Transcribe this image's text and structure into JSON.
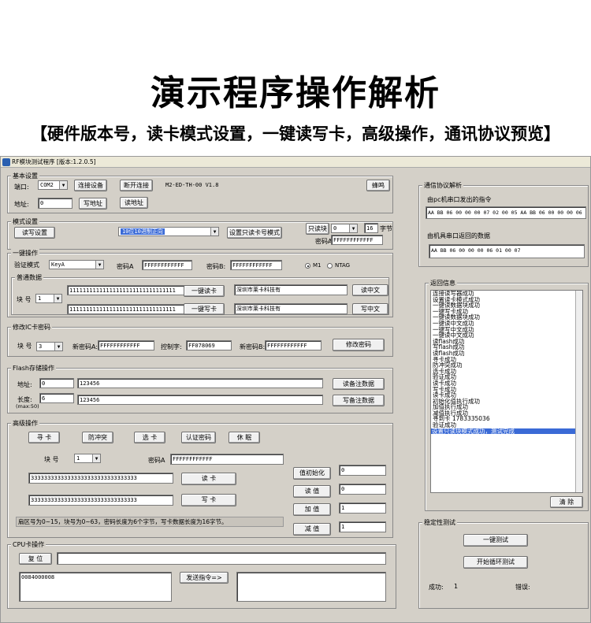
{
  "header": {
    "title": "演示程序操作解析",
    "subtitle": "【硬件版本号，读卡模式设置，一键读写卡，高级操作，通讯协议预览】"
  },
  "window": {
    "title": "RF模块测试程序 [版本:1.2.0.5]"
  },
  "basic": {
    "group": "基本设置",
    "port_label": "端口:",
    "port_value": "COM2",
    "connect": "连接设备",
    "disconnect": "断开连接",
    "version": "M2-ED-TH-00 V1.8",
    "buzzer": "蜂鸣",
    "addr_label": "地址:",
    "addr_value": "0",
    "write_addr": "写地址",
    "read_addr": "读地址"
  },
  "mode": {
    "group": "模式设置",
    "read_settings": "读写设置",
    "mode_value": "10位10进制正向",
    "set_mode": "设置只读卡号模式",
    "readonly_block": "只读块",
    "block_value": "0",
    "bytes_value": "16",
    "bytes_unit": "字节",
    "key_label": "密码A",
    "key_value": "FFFFFFFFFFFF"
  },
  "onekey": {
    "group": "一键操作",
    "verify_label": "验证模式",
    "verify_value": "KeyA",
    "keyA_label": "密码A",
    "keyA_value": "FFFFFFFFFFFF",
    "keyB_label": "密码B:",
    "keyB_value": "FFFFFFFFFFFF",
    "m1": "M1",
    "ntag": "NTAG",
    "normal_group": "普通数据",
    "block_label": "块 号",
    "block_value": "1",
    "data1": "11111111111111111111111111111111",
    "data2": "11111111111111111111111111111111",
    "read_card": "一键读卡",
    "write_card": "一键写卡",
    "cn1": "深圳市莱卡科技有",
    "cn2": "深圳市莱卡科技有",
    "read_cn": "读中文",
    "write_cn": "写中文"
  },
  "ic": {
    "group": "修改IC卡密码",
    "block_label": "块 号",
    "block_value": "3",
    "newA_label": "新密码A:",
    "newA_value": "FFFFFFFFFFFF",
    "ctrl_label": "控制字:",
    "ctrl_value": "FF078069",
    "newB_label": "新密码B:",
    "newB_value": "FFFFFFFFFFFF",
    "modify": "修改密码"
  },
  "flash": {
    "group": "Flash存储操作",
    "addr_label": "地址:",
    "addr_value": "0",
    "addr_data": "123456",
    "len_label": "长度:",
    "len_value": "6",
    "len_note": "(max:50)",
    "len_data": "123456",
    "read_note": "读备注数据",
    "write_note": "写备注数据"
  },
  "adv": {
    "group": "高级操作",
    "find": "寻 卡",
    "anticoll": "防冲突",
    "select": "选 卡",
    "auth": "认证密码",
    "halt": "休 眠",
    "block_label": "块 号",
    "block_value": "1",
    "keyA_label": "密码A",
    "keyA_value": "FFFFFFFFFFFF",
    "data1": "33333333333333333333333333333333",
    "data2": "33333333333333333333333333333333",
    "read": "读 卡",
    "write": "写 卡",
    "init": "值初始化",
    "init_value": "0",
    "readv": "读 值",
    "readv_value": "0",
    "add": "加 值",
    "add_value": "1",
    "sub": "减 值",
    "sub_value": "1",
    "note": "扇区号为0~15，块号为0~63，密码长度为6个字节，写卡数据长度为16字节。"
  },
  "cpu": {
    "group": "CPU卡操作",
    "reset": "复 位",
    "resp": "0084000008",
    "send": "发送指令=>"
  },
  "proto": {
    "group": "通信协议解析",
    "pc_label": "由pc机串口发出的指令",
    "pc_value": "AA BB 06 00 00 00 07 02 00 05 AA BB 06 00 00 00 06",
    "dev_label": "由机具串口返回的数据",
    "dev_value": "AA BB 06 00 00 00 06 01 00 07"
  },
  "ret": {
    "group": "返回信息",
    "lines": [
      "连接读写器成功",
      "设置读卡模式成功",
      "一键读数据块成功",
      "一键写卡成功",
      "一键读数据块成功",
      "一键读中文成功",
      "一键写中文成功",
      "一键读中文成功",
      "读flash成功",
      "写flash成功",
      "读flash成功",
      "寻卡成功",
      "防冲突成功",
      "选卡成功",
      "验证成功",
      "读卡成功",
      "写卡成功",
      "读卡成功",
      "初始化值执行成功",
      "加值执行成功",
      "减值执行成功",
      "寻到卡 1783335036",
      "验证成功"
    ],
    "selected": "设置只读块模式成功，测试完成",
    "clear": "清 除"
  },
  "stable": {
    "group": "稳定性测试",
    "one": "一键测试",
    "loop": "开始循环测试",
    "ok_label": "成功:",
    "ok_value": "1",
    "err_label": "错误:"
  }
}
